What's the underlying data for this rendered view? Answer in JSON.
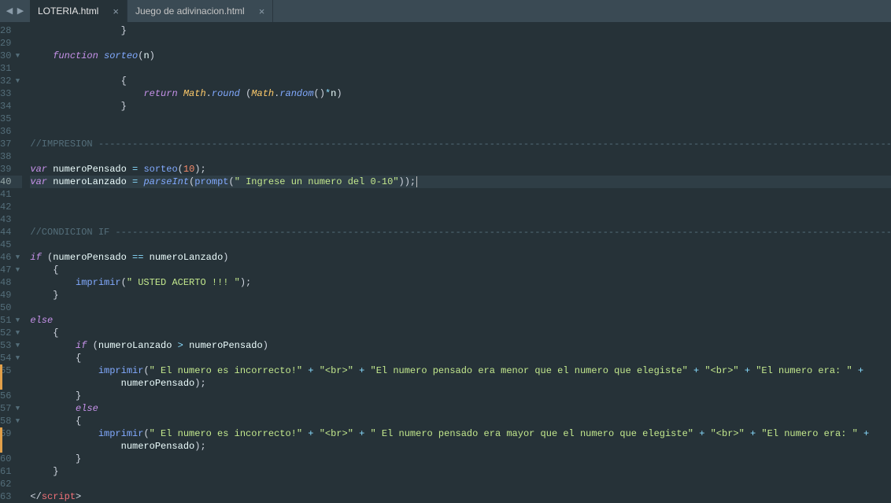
{
  "tabs": [
    {
      "label": "LOTERIA.html",
      "active": true
    },
    {
      "label": "Juego de adivinacion.html",
      "active": false
    }
  ],
  "lines": [
    {
      "n": 28,
      "fold": "",
      "mod": false,
      "tokens": [
        [
          "pn",
          "                "
        ],
        [
          "pn",
          "}"
        ]
      ]
    },
    {
      "n": 29,
      "fold": "",
      "mod": false,
      "tokens": []
    },
    {
      "n": 30,
      "fold": "▼",
      "mod": false,
      "tokens": [
        [
          "pn",
          "    "
        ],
        [
          "kw",
          "function"
        ],
        [
          "pn",
          " "
        ],
        [
          "fni",
          "sorteo"
        ],
        [
          "pn",
          "("
        ],
        [
          "var",
          "n"
        ],
        [
          "pn",
          ")"
        ]
      ]
    },
    {
      "n": 31,
      "fold": "",
      "mod": false,
      "tokens": []
    },
    {
      "n": 32,
      "fold": "▼",
      "mod": false,
      "tokens": [
        [
          "pn",
          "                "
        ],
        [
          "pn",
          "{"
        ]
      ]
    },
    {
      "n": 33,
      "fold": "",
      "mod": false,
      "tokens": [
        [
          "pn",
          "                    "
        ],
        [
          "kw",
          "return"
        ],
        [
          "pn",
          " "
        ],
        [
          "cls",
          "Math"
        ],
        [
          "pn",
          "."
        ],
        [
          "fni",
          "round"
        ],
        [
          "pn",
          " ("
        ],
        [
          "cls",
          "Math"
        ],
        [
          "pn",
          "."
        ],
        [
          "fni",
          "random"
        ],
        [
          "pn",
          "()"
        ],
        [
          "op",
          "*"
        ],
        [
          "var",
          "n"
        ],
        [
          "pn",
          ")"
        ]
      ]
    },
    {
      "n": 34,
      "fold": "",
      "mod": false,
      "tokens": [
        [
          "pn",
          "                "
        ],
        [
          "pn",
          "}"
        ]
      ]
    },
    {
      "n": 35,
      "fold": "",
      "mod": false,
      "tokens": []
    },
    {
      "n": 36,
      "fold": "",
      "mod": false,
      "tokens": []
    },
    {
      "n": 37,
      "fold": "",
      "mod": false,
      "tokens": [
        [
          "cmt",
          "//IMPRESION ---------------------------------------------------------------------------------------------------------------------------------------------------------------"
        ]
      ]
    },
    {
      "n": 38,
      "fold": "",
      "mod": false,
      "tokens": []
    },
    {
      "n": 39,
      "fold": "",
      "mod": false,
      "tokens": [
        [
          "kw",
          "var"
        ],
        [
          "pn",
          " "
        ],
        [
          "var",
          "numeroPensado"
        ],
        [
          "pn",
          " "
        ],
        [
          "op",
          "="
        ],
        [
          "pn",
          " "
        ],
        [
          "fn",
          "sorteo"
        ],
        [
          "pn",
          "("
        ],
        [
          "num",
          "10"
        ],
        [
          "pn",
          ");"
        ]
      ]
    },
    {
      "n": 40,
      "fold": "",
      "mod": false,
      "hl": true,
      "tokens": [
        [
          "kw",
          "var"
        ],
        [
          "pn",
          " "
        ],
        [
          "var",
          "numeroLanzado"
        ],
        [
          "pn",
          " "
        ],
        [
          "op",
          "="
        ],
        [
          "pn",
          " "
        ],
        [
          "fni",
          "parseInt"
        ],
        [
          "pn",
          "("
        ],
        [
          "fn",
          "prompt"
        ],
        [
          "pn",
          "("
        ],
        [
          "str",
          "\" Ingrese un numero del 0-10\""
        ],
        [
          "pn",
          "));"
        ]
      ],
      "cursor": true
    },
    {
      "n": 41,
      "fold": "",
      "mod": false,
      "tokens": []
    },
    {
      "n": 42,
      "fold": "",
      "mod": false,
      "tokens": []
    },
    {
      "n": 43,
      "fold": "",
      "mod": false,
      "tokens": []
    },
    {
      "n": 44,
      "fold": "",
      "mod": false,
      "tokens": [
        [
          "cmt",
          "//CONDICION IF ------------------------------------------------------------------------------------------------------------------------------------------------------------"
        ]
      ]
    },
    {
      "n": 45,
      "fold": "",
      "mod": false,
      "tokens": []
    },
    {
      "n": 46,
      "fold": "▼",
      "mod": false,
      "tokens": [
        [
          "kw",
          "if"
        ],
        [
          "pn",
          " ("
        ],
        [
          "var",
          "numeroPensado"
        ],
        [
          "pn",
          " "
        ],
        [
          "op",
          "=="
        ],
        [
          "pn",
          " "
        ],
        [
          "var",
          "numeroLanzado"
        ],
        [
          "pn",
          ")"
        ]
      ]
    },
    {
      "n": 47,
      "fold": "▼",
      "mod": false,
      "tokens": [
        [
          "pn",
          "    {"
        ]
      ]
    },
    {
      "n": 48,
      "fold": "",
      "mod": false,
      "tokens": [
        [
          "pn",
          "        "
        ],
        [
          "fn",
          "imprimir"
        ],
        [
          "pn",
          "("
        ],
        [
          "str",
          "\" USTED ACERTO !!! \""
        ],
        [
          "pn",
          ");"
        ]
      ]
    },
    {
      "n": 49,
      "fold": "",
      "mod": false,
      "tokens": [
        [
          "pn",
          "    }"
        ]
      ]
    },
    {
      "n": 50,
      "fold": "",
      "mod": false,
      "tokens": []
    },
    {
      "n": 51,
      "fold": "▼",
      "mod": false,
      "tokens": [
        [
          "kw",
          "else"
        ]
      ]
    },
    {
      "n": 52,
      "fold": "▼",
      "mod": false,
      "tokens": [
        [
          "pn",
          "    {"
        ]
      ]
    },
    {
      "n": 53,
      "fold": "▼",
      "mod": false,
      "tokens": [
        [
          "pn",
          "        "
        ],
        [
          "kw",
          "if"
        ],
        [
          "pn",
          " ("
        ],
        [
          "var",
          "numeroLanzado"
        ],
        [
          "pn",
          " "
        ],
        [
          "op",
          ">"
        ],
        [
          "pn",
          " "
        ],
        [
          "var",
          "numeroPensado"
        ],
        [
          "pn",
          ")"
        ]
      ]
    },
    {
      "n": 54,
      "fold": "▼",
      "mod": false,
      "tokens": [
        [
          "pn",
          "        {"
        ]
      ]
    },
    {
      "n": 55,
      "fold": "",
      "mod": true,
      "tokens": [
        [
          "pn",
          "            "
        ],
        [
          "fn",
          "imprimir"
        ],
        [
          "pn",
          "("
        ],
        [
          "str",
          "\" El numero es incorrecto!\""
        ],
        [
          "pn",
          " "
        ],
        [
          "op",
          "+"
        ],
        [
          "pn",
          " "
        ],
        [
          "str",
          "\"<br>\""
        ],
        [
          "pn",
          " "
        ],
        [
          "op",
          "+"
        ],
        [
          "pn",
          " "
        ],
        [
          "str",
          "\"El numero pensado era menor que el numero que elegiste\""
        ],
        [
          "pn",
          " "
        ],
        [
          "op",
          "+"
        ],
        [
          "pn",
          " "
        ],
        [
          "str",
          "\"<br>\""
        ],
        [
          "pn",
          " "
        ],
        [
          "op",
          "+"
        ],
        [
          "pn",
          " "
        ],
        [
          "str",
          "\"El numero era: \""
        ],
        [
          "pn",
          " "
        ],
        [
          "op",
          "+"
        ],
        [
          "pn",
          " "
        ]
      ]
    },
    {
      "n": "",
      "fold": "",
      "mod": true,
      "cont": true,
      "tokens": [
        [
          "pn",
          "                "
        ],
        [
          "var",
          "numeroPensado"
        ],
        [
          "pn",
          ");"
        ]
      ]
    },
    {
      "n": 56,
      "fold": "",
      "mod": false,
      "tokens": [
        [
          "pn",
          "        }"
        ]
      ]
    },
    {
      "n": 57,
      "fold": "▼",
      "mod": false,
      "tokens": [
        [
          "pn",
          "        "
        ],
        [
          "kw",
          "else"
        ]
      ]
    },
    {
      "n": 58,
      "fold": "▼",
      "mod": false,
      "tokens": [
        [
          "pn",
          "        {"
        ]
      ]
    },
    {
      "n": 59,
      "fold": "",
      "mod": true,
      "tokens": [
        [
          "pn",
          "            "
        ],
        [
          "fn",
          "imprimir"
        ],
        [
          "pn",
          "("
        ],
        [
          "str",
          "\" El numero es incorrecto!\""
        ],
        [
          "pn",
          " "
        ],
        [
          "op",
          "+"
        ],
        [
          "pn",
          " "
        ],
        [
          "str",
          "\"<br>\""
        ],
        [
          "pn",
          " "
        ],
        [
          "op",
          "+"
        ],
        [
          "pn",
          " "
        ],
        [
          "str",
          "\" El numero pensado era mayor que el numero que elegiste\""
        ],
        [
          "pn",
          " "
        ],
        [
          "op",
          "+"
        ],
        [
          "pn",
          " "
        ],
        [
          "str",
          "\"<br>\""
        ],
        [
          "pn",
          " "
        ],
        [
          "op",
          "+"
        ],
        [
          "pn",
          " "
        ],
        [
          "str",
          "\"El numero era: \""
        ],
        [
          "pn",
          " "
        ],
        [
          "op",
          "+"
        ],
        [
          "pn",
          " "
        ]
      ]
    },
    {
      "n": "",
      "fold": "",
      "mod": true,
      "cont": true,
      "tokens": [
        [
          "pn",
          "                "
        ],
        [
          "var",
          "numeroPensado"
        ],
        [
          "pn",
          ");"
        ]
      ]
    },
    {
      "n": 60,
      "fold": "",
      "mod": false,
      "tokens": [
        [
          "pn",
          "        }"
        ]
      ]
    },
    {
      "n": 61,
      "fold": "",
      "mod": false,
      "tokens": [
        [
          "pn",
          "    }"
        ]
      ]
    },
    {
      "n": 62,
      "fold": "",
      "mod": false,
      "tokens": []
    },
    {
      "n": 63,
      "fold": "",
      "mod": false,
      "tokens": [
        [
          "pn",
          "</"
        ],
        [
          "tag",
          "script"
        ],
        [
          "pn",
          ">"
        ]
      ]
    }
  ]
}
